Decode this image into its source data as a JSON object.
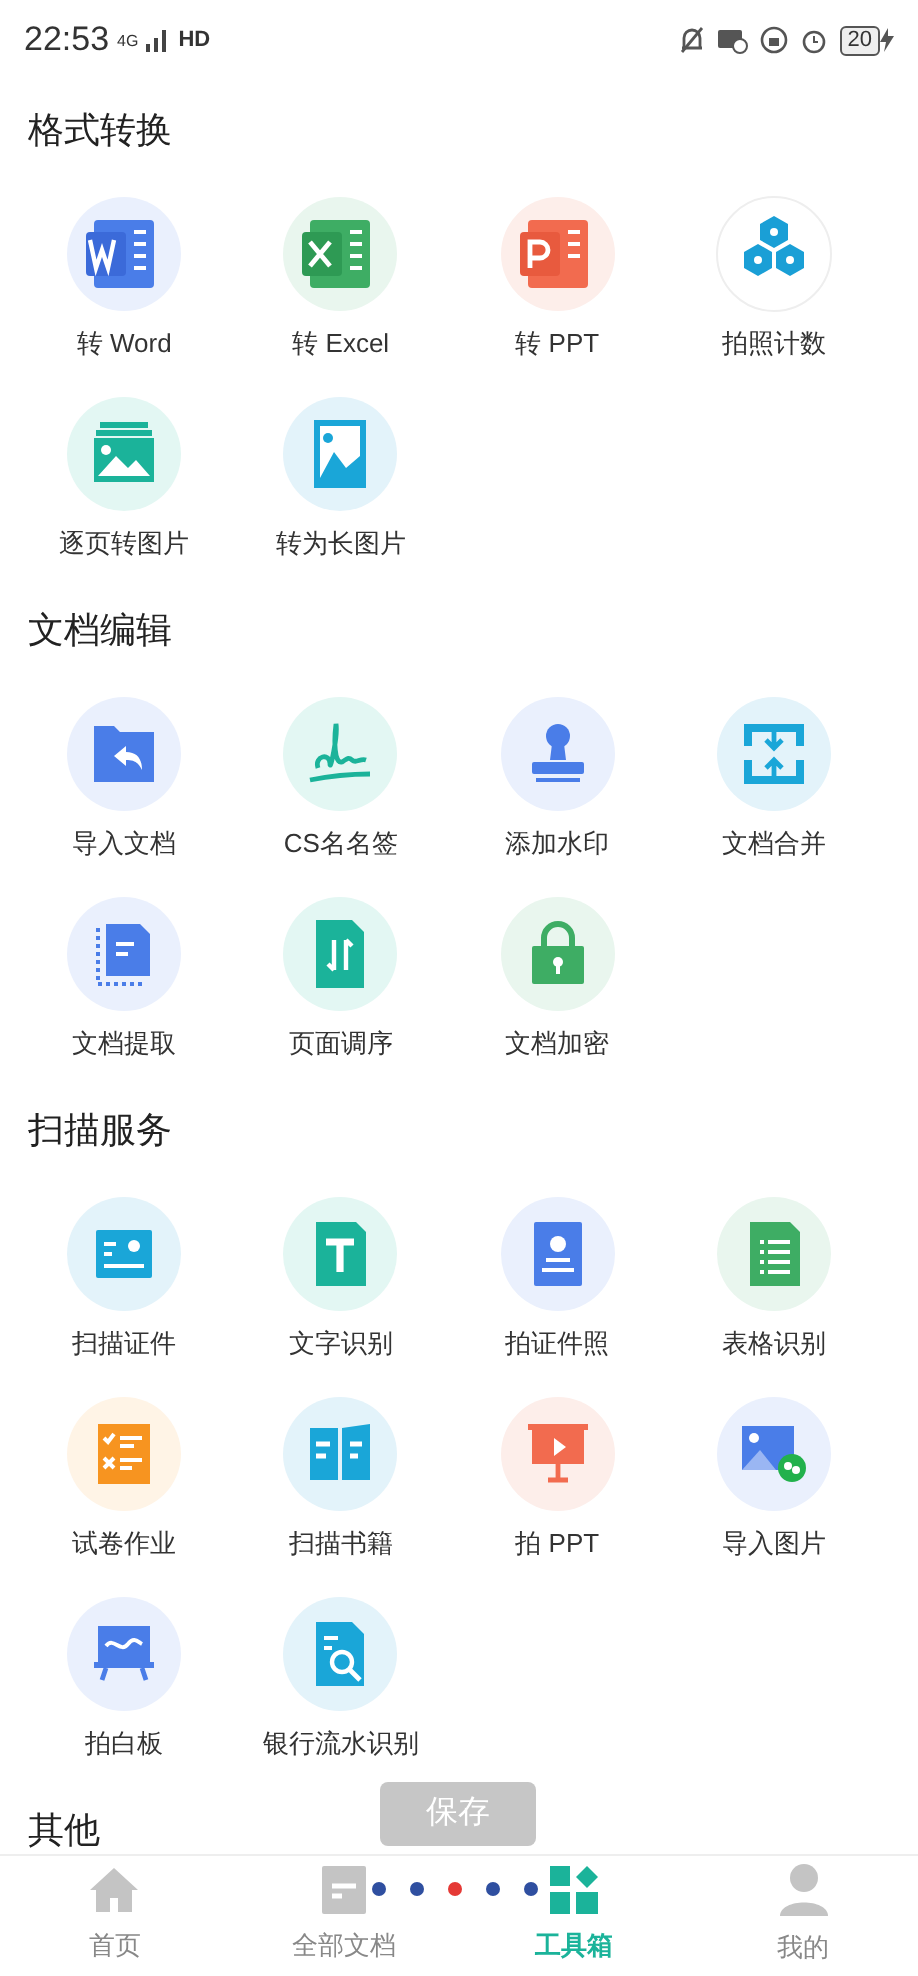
{
  "status_bar": {
    "time": "22:53",
    "network": "4G",
    "hd": "HD",
    "battery": "20"
  },
  "sections": [
    {
      "title": "格式转换",
      "tools": [
        {
          "label": "转 Word"
        },
        {
          "label": "转 Excel"
        },
        {
          "label": "转 PPT"
        },
        {
          "label": "拍照计数"
        },
        {
          "label": "逐页转图片"
        },
        {
          "label": "转为长图片"
        }
      ]
    },
    {
      "title": "文档编辑",
      "tools": [
        {
          "label": "导入文档"
        },
        {
          "label": "CS名名签"
        },
        {
          "label": "添加水印"
        },
        {
          "label": "文档合并"
        },
        {
          "label": "文档提取"
        },
        {
          "label": "页面调序"
        },
        {
          "label": "文档加密"
        }
      ]
    },
    {
      "title": "扫描服务",
      "tools": [
        {
          "label": "扫描证件"
        },
        {
          "label": "文字识别"
        },
        {
          "label": "拍证件照"
        },
        {
          "label": "表格识别"
        },
        {
          "label": "试卷作业"
        },
        {
          "label": "扫描书籍"
        },
        {
          "label": "拍 PPT"
        },
        {
          "label": "导入图片"
        },
        {
          "label": "拍白板"
        },
        {
          "label": "银行流水识别"
        }
      ]
    },
    {
      "title": "其他"
    }
  ],
  "save_button": {
    "label": "保存",
    "disabled": true
  },
  "loading_dots": [
    {
      "color": "#2f4fa0"
    },
    {
      "color": "#2f4fa0"
    },
    {
      "color": "#e53935"
    },
    {
      "color": "#2f4fa0"
    },
    {
      "color": "#2f4fa0"
    }
  ],
  "nav": [
    {
      "label": "首页",
      "selected": false
    },
    {
      "label": "全部文档",
      "selected": false
    },
    {
      "label": "工具箱",
      "selected": true
    },
    {
      "label": "我的",
      "selected": false
    }
  ]
}
